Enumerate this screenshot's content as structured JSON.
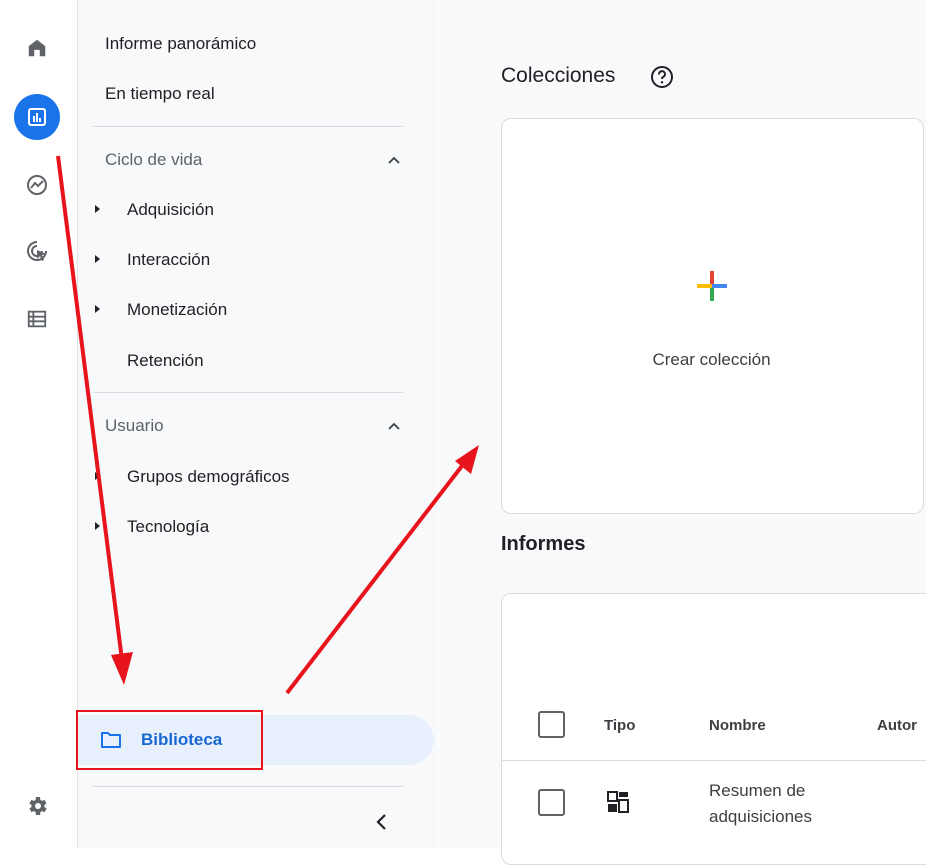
{
  "nav": {
    "overview": "Informe panorámico",
    "realtime": "En tiempo real",
    "lifecycle": {
      "title": "Ciclo de vida",
      "items": [
        "Adquisición",
        "Interacción",
        "Monetización",
        "Retención"
      ]
    },
    "user": {
      "title": "Usuario",
      "items": [
        "Grupos demográficos",
        "Tecnología"
      ]
    },
    "library": "Biblioteca"
  },
  "main": {
    "collections_title": "Colecciones",
    "create_collection": "Crear colección",
    "reports_title": "Informes",
    "table": {
      "headers": [
        "Tipo",
        "Nombre",
        "Autor"
      ],
      "rows": [
        {
          "name": "Resumen de adquisiciones"
        }
      ]
    }
  },
  "icons": [
    "home-icon",
    "reports-icon",
    "explore-icon",
    "advertising-icon",
    "configure-icon",
    "settings-icon",
    "help-icon",
    "folder-icon",
    "collapse-icon",
    "chevron-up-icon",
    "plus-icon",
    "report-type-icon"
  ],
  "colors": {
    "accent": "#1a73e8",
    "annotation": "#e8141d",
    "plus_blue": "#4285f4",
    "plus_red": "#ea4335",
    "plus_yellow": "#fbbc04",
    "plus_green": "#34a853"
  }
}
